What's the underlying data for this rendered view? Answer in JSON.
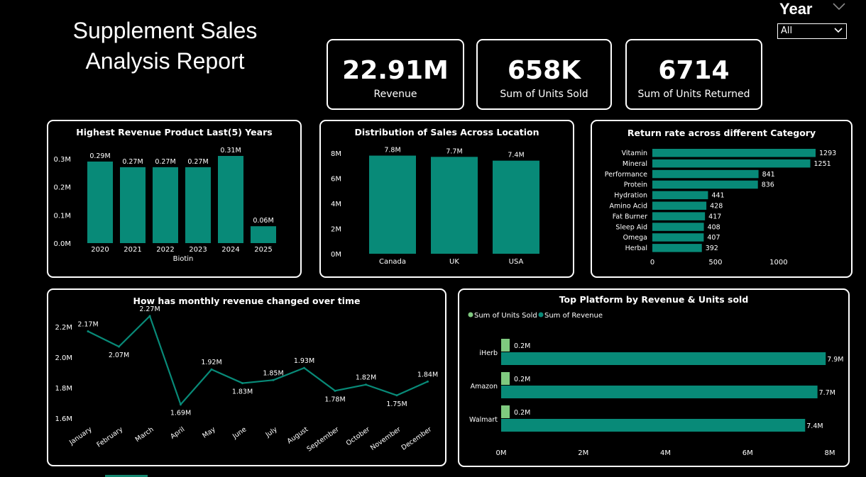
{
  "report": {
    "title_line1": "Supplement Sales",
    "title_line2": "Analysis Report"
  },
  "colors": {
    "teal": "#088a78",
    "light_green": "#7fc97f",
    "background": "#000000",
    "border": "#ffffff"
  },
  "slicer": {
    "label": "Year",
    "selected": "All",
    "icon": "chevron-down-icon"
  },
  "kpis": [
    {
      "value": "22.91M",
      "label": "Revenue"
    },
    {
      "value": "658K",
      "label": "Sum of Units Sold"
    },
    {
      "value": "6714",
      "label": "Sum of Units Returned"
    }
  ],
  "chart_data": [
    {
      "id": "revenue_by_year",
      "type": "bar",
      "title": "Highest Revenue Product Last(5) Years",
      "xlabel": "Biotin",
      "categories": [
        "2020",
        "2021",
        "2022",
        "2023",
        "2024",
        "2025"
      ],
      "values": [
        0.29,
        0.27,
        0.27,
        0.27,
        0.31,
        0.06
      ],
      "data_labels": [
        "0.29M",
        "0.27M",
        "0.27M",
        "0.27M",
        "0.31M",
        "0.06M"
      ],
      "yticks": [
        "0.0M",
        "0.1M",
        "0.2M",
        "0.3M"
      ],
      "ylim": [
        0,
        0.31
      ],
      "grid": false
    },
    {
      "id": "sales_by_location",
      "type": "bar",
      "title": "Distribution of Sales Across Location",
      "categories": [
        "Canada",
        "UK",
        "USA"
      ],
      "values": [
        7.8,
        7.7,
        7.4
      ],
      "data_labels": [
        "7.8M",
        "7.7M",
        "7.4M"
      ],
      "yticks": [
        "0M",
        "2M",
        "4M",
        "6M",
        "8M"
      ],
      "ylim": [
        0,
        8
      ],
      "grid": false
    },
    {
      "id": "return_rate_category",
      "type": "bar",
      "orientation": "horizontal",
      "title": "Return rate across different Category",
      "categories": [
        "Vitamin",
        "Mineral",
        "Performance",
        "Protein",
        "Hydration",
        "Amino Acid",
        "Fat Burner",
        "Sleep Aid",
        "Omega",
        "Herbal"
      ],
      "values": [
        1293,
        1251,
        841,
        836,
        441,
        428,
        417,
        408,
        407,
        392
      ],
      "data_labels": [
        "1293",
        "1251",
        "841",
        "836",
        "441",
        "428",
        "417",
        "408",
        "407",
        "392"
      ],
      "xticks": [
        "0",
        "500",
        "1000"
      ],
      "xlim": [
        0,
        1293
      ],
      "grid": false
    },
    {
      "id": "monthly_revenue",
      "type": "line",
      "title": "How has monthly revenue changed over time",
      "categories": [
        "January",
        "February",
        "March",
        "April",
        "May",
        "June",
        "July",
        "August",
        "September",
        "October",
        "November",
        "December"
      ],
      "values": [
        2.17,
        2.07,
        2.27,
        1.69,
        1.92,
        1.83,
        1.85,
        1.93,
        1.78,
        1.82,
        1.75,
        1.84
      ],
      "data_labels": [
        "2.17M",
        "2.07M",
        "2.27M",
        "1.69M",
        "1.92M",
        "1.83M",
        "1.85M",
        "1.93M",
        "1.78M",
        "1.82M",
        "1.75M",
        "1.84M"
      ],
      "yticks": [
        "1.6M",
        "1.8M",
        "2.0M",
        "2.2M"
      ],
      "ylim": [
        1.6,
        2.27
      ],
      "grid": false
    },
    {
      "id": "platform_revenue_units",
      "type": "bar",
      "orientation": "horizontal",
      "title": "Top Platform by Revenue & Units sold",
      "legend": "top-left",
      "categories": [
        "iHerb",
        "Amazon",
        "Walmart"
      ],
      "series": [
        {
          "name": "Sum of Units Sold",
          "color": "#7fc97f",
          "values": [
            0.2,
            0.2,
            0.2
          ],
          "data_labels": [
            "0.2M",
            "0.2M",
            "0.2M"
          ]
        },
        {
          "name": "Sum of Revenue",
          "color": "#088a78",
          "values": [
            7.9,
            7.7,
            7.4
          ],
          "data_labels": [
            "7.9M",
            "7.7M",
            "7.4M"
          ]
        }
      ],
      "xticks": [
        "0M",
        "2M",
        "4M",
        "6M",
        "8M"
      ],
      "xlim": [
        0,
        8
      ],
      "grid": false
    }
  ]
}
